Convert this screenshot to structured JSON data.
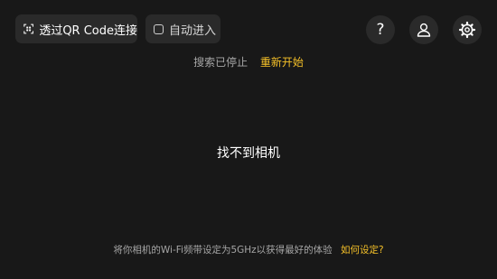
{
  "header": {
    "qr_button_label": "透过QR Code连接",
    "auto_enter_label": "自动进入",
    "auto_enter_checked": false,
    "help_label": "?"
  },
  "status": {
    "text": "搜索已停止",
    "restart_label": "重新开始"
  },
  "main": {
    "message": "找不到相机"
  },
  "footer": {
    "hint": "将你相机的Wi-Fi频带设定为5GHz以获得最好的体验",
    "link_label": "如何设定?"
  },
  "colors": {
    "background": "#181818",
    "button_bg": "#2a2a2a",
    "accent": "#f5c028",
    "muted_text": "#a6a6a6"
  },
  "icons": [
    "qr-code-scan-icon",
    "checkbox-icon",
    "help-icon",
    "account-icon",
    "settings-gear-icon"
  ]
}
